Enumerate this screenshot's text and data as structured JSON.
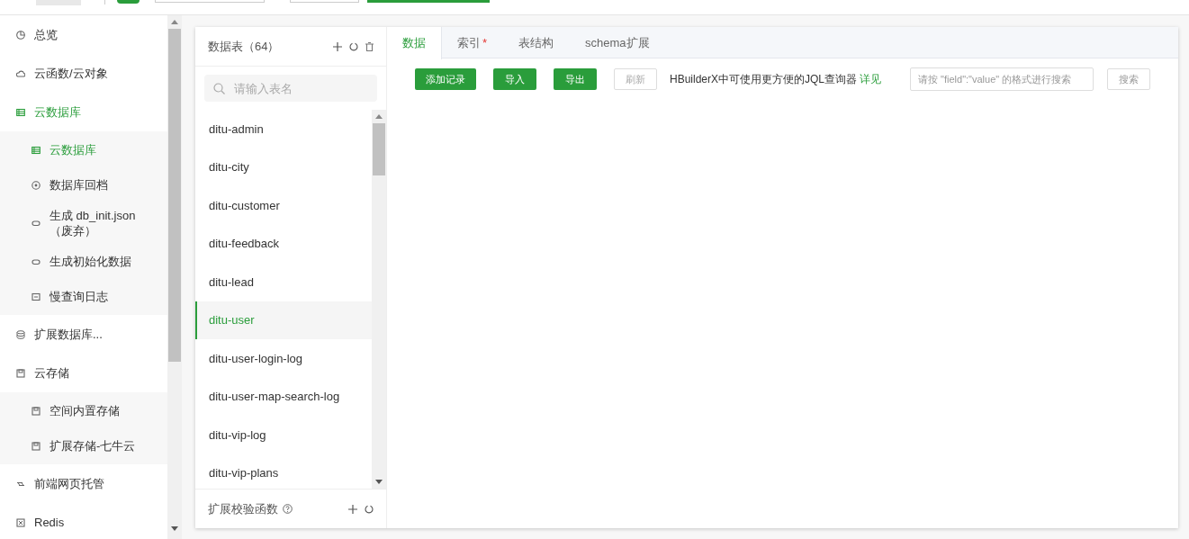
{
  "sidebar": {
    "items": [
      {
        "label": "总览",
        "selected": false
      },
      {
        "label": "云函数/云对象",
        "selected": false
      },
      {
        "label": "云数据库",
        "selected": true,
        "children": [
          {
            "label": "云数据库",
            "selected": true
          },
          {
            "label": "数据库回档",
            "selected": false
          },
          {
            "label": "生成 db_init.json（废弃）",
            "selected": false
          },
          {
            "label": "生成初始化数据",
            "selected": false
          },
          {
            "label": "慢查询日志",
            "selected": false
          }
        ]
      },
      {
        "label": "扩展数据库...",
        "selected": false
      },
      {
        "label": "云存储",
        "selected": false,
        "children": [
          {
            "label": "空间内置存储",
            "selected": false
          },
          {
            "label": "扩展存储-七牛云",
            "selected": false
          }
        ]
      },
      {
        "label": "前端网页托管",
        "selected": false
      },
      {
        "label": "Redis",
        "selected": false
      }
    ]
  },
  "tables_panel": {
    "title": "数据表（64）",
    "search": {
      "placeholder": "请输入表名"
    },
    "tables": [
      {
        "name": "ditu-admin",
        "selected": false
      },
      {
        "name": "ditu-city",
        "selected": false
      },
      {
        "name": "ditu-customer",
        "selected": false
      },
      {
        "name": "ditu-feedback",
        "selected": false
      },
      {
        "name": "ditu-lead",
        "selected": false
      },
      {
        "name": "ditu-user",
        "selected": true
      },
      {
        "name": "ditu-user-login-log",
        "selected": false
      },
      {
        "name": "ditu-user-map-search-log",
        "selected": false
      },
      {
        "name": "ditu-vip-log",
        "selected": false
      },
      {
        "name": "ditu-vip-plans",
        "selected": false
      }
    ],
    "footer": "扩展校验函数"
  },
  "tabs": [
    {
      "label": "数据",
      "selected": true
    },
    {
      "label": "索引",
      "marker": "*",
      "selected": false
    },
    {
      "label": "表结构",
      "selected": false
    },
    {
      "label": "schema扩展",
      "selected": false
    }
  ],
  "toolbar": {
    "buttons": [
      {
        "label": "添加记录",
        "disabled": false
      },
      {
        "label": "导入",
        "disabled": false
      },
      {
        "label": "导出",
        "disabled": false
      },
      {
        "label": "刷新",
        "disabled": true
      }
    ],
    "hint": "HBuilderX中可使用更方便的JQL查询器",
    "hint_link": "详见",
    "search": {
      "placeholder": "请按 \"field\":\"value\" 的格式进行搜索"
    },
    "search_button": "搜索"
  }
}
